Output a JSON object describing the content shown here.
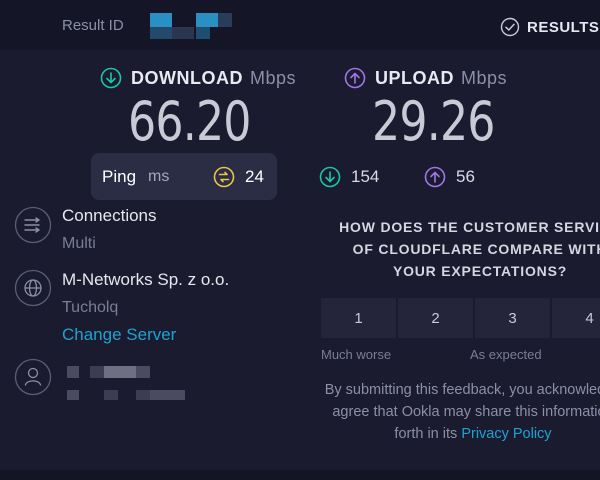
{
  "header": {
    "result_id_label": "Result ID",
    "results_label": "RESULTS"
  },
  "download": {
    "label": "DOWNLOAD",
    "unit": "Mbps",
    "value": "66.20",
    "color": "#1cc6a6"
  },
  "upload": {
    "label": "UPLOAD",
    "unit": "Mbps",
    "value": "29.26",
    "color": "#a274e6"
  },
  "ping": {
    "label": "Ping",
    "unit": "ms",
    "value": "24",
    "color": "#e8c547"
  },
  "latency": {
    "download_value": "154",
    "upload_value": "56"
  },
  "connections": {
    "title": "Connections",
    "value": "Multi"
  },
  "server": {
    "provider": "M-Networks Sp. z o.o.",
    "location": "Tucholq",
    "change_label": "Change Server"
  },
  "survey": {
    "question": "HOW DOES THE CUSTOMER SERVICE OF CLOUDFLARE COMPARE WITH YOUR EXPECTATIONS?",
    "options": [
      "1",
      "2",
      "3",
      "4"
    ],
    "low_label": "Much worse",
    "mid_label": "As expected"
  },
  "disclaimer": {
    "line1": "By submitting this feedback, you acknowledge",
    "line2": "agree that Ookla may share this information",
    "line3_prefix": "forth in its ",
    "privacy_link": "Privacy Policy"
  },
  "icons": {
    "results": "check-circle-icon",
    "download": "arrow-down-circle-icon",
    "upload": "arrow-up-circle-icon",
    "ping": "ping-circle-icon",
    "connections": "connections-icon",
    "server": "globe-icon",
    "user": "user-icon"
  }
}
